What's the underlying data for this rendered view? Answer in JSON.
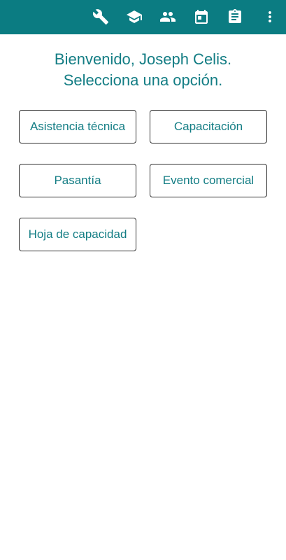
{
  "toolbar": {
    "background": "#0b7c82",
    "icons": [
      {
        "name": "wrench-icon"
      },
      {
        "name": "graduation-cap-icon"
      },
      {
        "name": "people-icon"
      },
      {
        "name": "calendar-icon"
      },
      {
        "name": "clipboard-icon"
      },
      {
        "name": "more-vert-icon"
      }
    ]
  },
  "welcome": {
    "line1": "Bienvenido, Joseph Celis.",
    "line2": "Selecciona una opción.",
    "color": "#137d84"
  },
  "options": {
    "asistencia_tecnica": "Asistencia técnica",
    "capacitacion": "Capacitación",
    "pasantia": "Pasantía",
    "evento_comercial": "Evento comercial",
    "hoja_de_capacidad": "Hoja de capacidad"
  }
}
